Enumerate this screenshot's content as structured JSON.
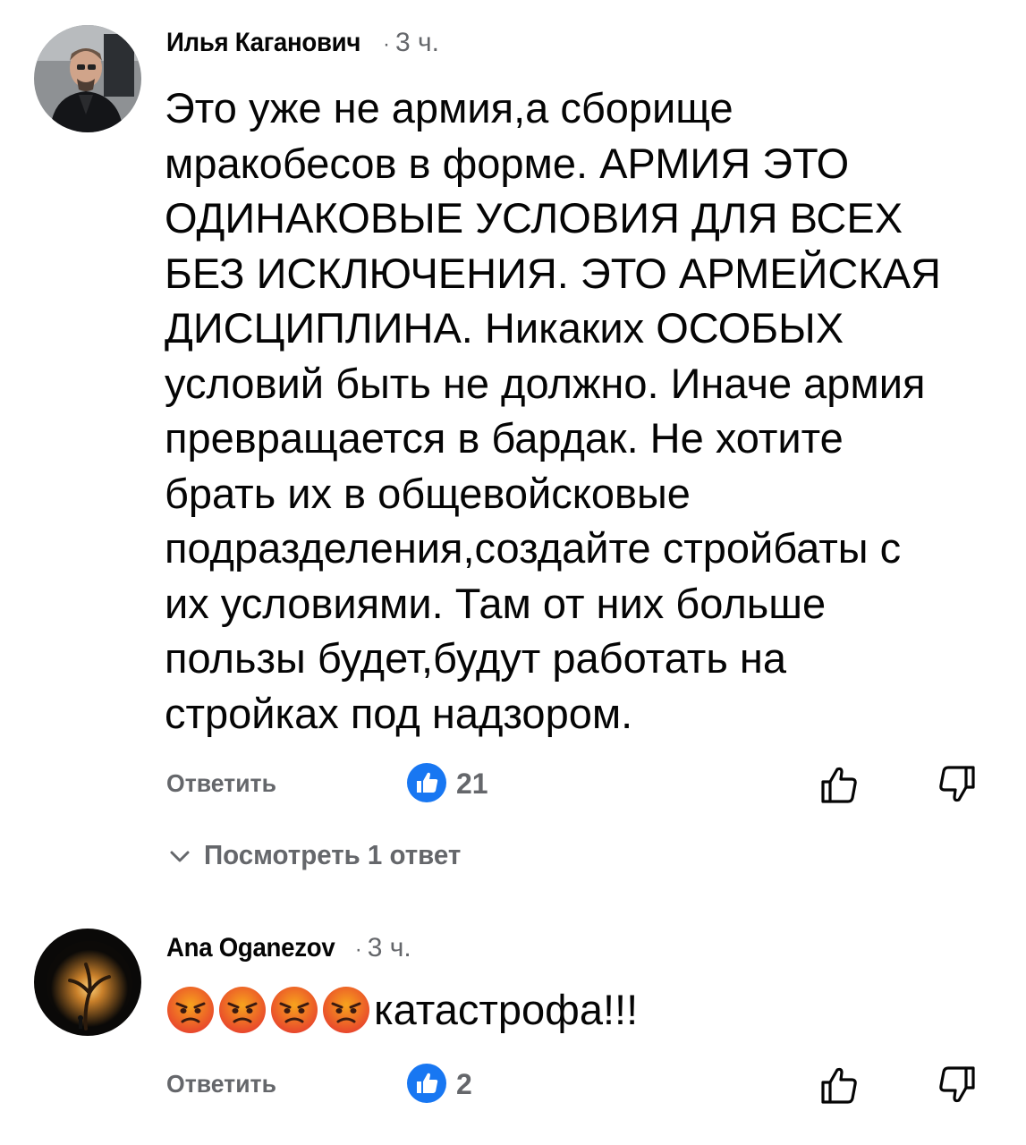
{
  "comments": [
    {
      "author": "Илья Каганович",
      "time": "3 ч.",
      "text": "Это уже не армия,а сборище\nмракобесов в форме. АРМИЯ  ЭТО\nОДИНАКОВЫЕ  УСЛОВИЯ  ДЛЯ  ВСЕХ\nБЕЗ  ИСКЛЮЧЕНИЯ. ЭТО  АРМЕЙСКАЯ\nДИСЦИПЛИНА. Никаких ОСОБЫХ\nусловий быть не должно. Иначе армия\nпревращается в бардак. Не хотите\nбрать их в общевойсковые\nподразделения,создайте стройбаты с\nих условиями. Там от них больше\nпользы будет,будут работать на\nстройках под надзором.",
      "reply_label": "Ответить",
      "likes": "21",
      "view_replies": "Посмотреть 1 ответ"
    },
    {
      "author": "Ana Oganezov",
      "time": "3 ч.",
      "emoji": "angry-face",
      "emoji_count": 4,
      "text": "катастрофа!!!",
      "reply_label": "Ответить",
      "likes": "2"
    }
  ],
  "colors": {
    "text": "#050505",
    "secondary": "#65676b",
    "like_blue": "#1877f2",
    "emoji_red": "#e8452c",
    "emoji_orange": "#f7a41d"
  },
  "icons": {
    "like_badge": "thumbs-up-badge-icon",
    "like": "thumbs-up-outline-icon",
    "dislike": "thumbs-down-outline-icon",
    "expand": "chevron-down-icon"
  }
}
